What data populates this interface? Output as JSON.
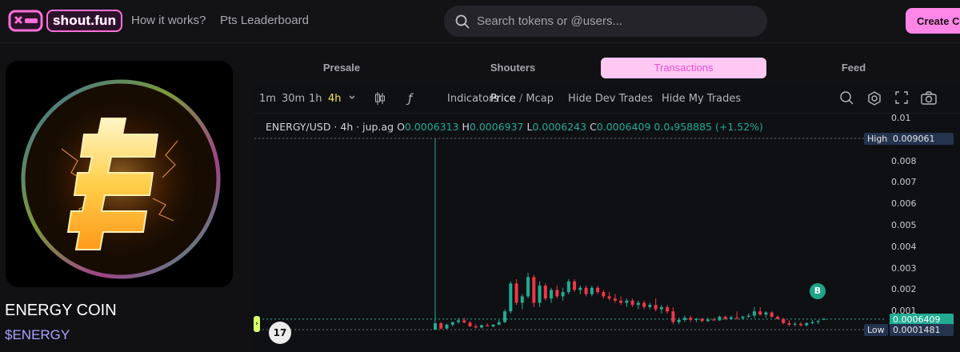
{
  "brand": {
    "name": "shout.fun"
  },
  "nav": {
    "how_it_works": "How it works?",
    "leaderboard": "Pts Leaderboard"
  },
  "search": {
    "placeholder": "Search tokens or @users..."
  },
  "create_button": "Create Coin",
  "coin": {
    "name": "ENERGY COIN",
    "ticker": "$ENERGY"
  },
  "tabs": [
    {
      "label": "Presale",
      "active": false
    },
    {
      "label": "Shouters",
      "active": false
    },
    {
      "label": "Transactions",
      "active": true
    },
    {
      "label": "Feed",
      "active": false
    }
  ],
  "chart_toolbar": {
    "intervals": [
      "1m",
      "30m",
      "1h",
      "4h"
    ],
    "selected_interval": "4h",
    "indicators": "Indicators",
    "price": "Price",
    "separator": "/",
    "mcap": "Mcap",
    "hide_dev": "Hide Dev Trades",
    "hide_my": "Hide My Trades",
    "icons": [
      "candles-icon",
      "fx-icon",
      "zoom-icon",
      "settings-icon",
      "fullscreen-icon",
      "camera-icon"
    ]
  },
  "ohlc": {
    "symbol": "ENERGY/USD · 4h · jup.ag",
    "o_label": "O",
    "o": "0.0006313",
    "h_label": "H",
    "h": "0.0006937",
    "l_label": "L",
    "l": "0.0006243",
    "c_label": "C",
    "c": "0.0006409",
    "change": "0.0₄958885 (+1.52%)"
  },
  "markers": {
    "tv": "17",
    "buy": "B"
  },
  "colors": {
    "up": "#22ab94",
    "down": "#f23645",
    "accent": "#ff86e6",
    "interval_selected": "#f5e44a"
  },
  "chart_data": {
    "type": "candlestick",
    "symbol": "ENERGY/USD",
    "interval": "4h",
    "y_ticks": [
      "0.01",
      "0.008",
      "0.007",
      "0.006",
      "0.005",
      "0.004",
      "0.003",
      "0.002",
      "0.001"
    ],
    "ylim": [
      0,
      0.01
    ],
    "price_tags": [
      {
        "label": "High",
        "value": "0.009061"
      },
      {
        "label": "",
        "value": "0.0006409"
      },
      {
        "label": "Low",
        "value": "0.0001481"
      }
    ],
    "candles": [
      {
        "o": 0.0001481,
        "h": 0.009061,
        "l": 0.0001481,
        "c": 0.00045
      },
      {
        "o": 0.00045,
        "h": 0.0005,
        "l": 0.00015,
        "c": 0.0002
      },
      {
        "o": 0.0002,
        "h": 0.00042,
        "l": 0.00018,
        "c": 0.00038
      },
      {
        "o": 0.00038,
        "h": 0.00052,
        "l": 0.0003,
        "c": 0.0005
      },
      {
        "o": 0.0005,
        "h": 0.0007,
        "l": 0.00042,
        "c": 0.00058
      },
      {
        "o": 0.00058,
        "h": 0.0007,
        "l": 0.00045,
        "c": 0.00048
      },
      {
        "o": 0.00048,
        "h": 0.00055,
        "l": 0.00028,
        "c": 0.0003
      },
      {
        "o": 0.0003,
        "h": 0.0004,
        "l": 0.0002,
        "c": 0.00025
      },
      {
        "o": 0.00025,
        "h": 0.0004,
        "l": 0.0002,
        "c": 0.00035
      },
      {
        "o": 0.00035,
        "h": 0.00045,
        "l": 0.0003,
        "c": 0.0003
      },
      {
        "o": 0.0003,
        "h": 0.0004,
        "l": 0.00025,
        "c": 0.00038
      },
      {
        "o": 0.00038,
        "h": 0.0006,
        "l": 0.00035,
        "c": 0.0005
      },
      {
        "o": 0.0005,
        "h": 0.0011,
        "l": 0.00045,
        "c": 0.001
      },
      {
        "o": 0.001,
        "h": 0.0024,
        "l": 0.0009,
        "c": 0.0023
      },
      {
        "o": 0.0023,
        "h": 0.0025,
        "l": 0.0013,
        "c": 0.0014
      },
      {
        "o": 0.0014,
        "h": 0.0018,
        "l": 0.0011,
        "c": 0.0017
      },
      {
        "o": 0.0017,
        "h": 0.0028,
        "l": 0.0016,
        "c": 0.0026
      },
      {
        "o": 0.0026,
        "h": 0.0027,
        "l": 0.0012,
        "c": 0.0014
      },
      {
        "o": 0.0014,
        "h": 0.0024,
        "l": 0.0012,
        "c": 0.0022
      },
      {
        "o": 0.0022,
        "h": 0.0023,
        "l": 0.0015,
        "c": 0.0016
      },
      {
        "o": 0.0016,
        "h": 0.0021,
        "l": 0.0014,
        "c": 0.002
      },
      {
        "o": 0.002,
        "h": 0.0022,
        "l": 0.0016,
        "c": 0.0017
      },
      {
        "o": 0.0017,
        "h": 0.0021,
        "l": 0.0015,
        "c": 0.0019
      },
      {
        "o": 0.0019,
        "h": 0.0025,
        "l": 0.0018,
        "c": 0.0024
      },
      {
        "o": 0.0024,
        "h": 0.0025,
        "l": 0.0019,
        "c": 0.002
      },
      {
        "o": 0.002,
        "h": 0.0022,
        "l": 0.0018,
        "c": 0.0021
      },
      {
        "o": 0.0021,
        "h": 0.0022,
        "l": 0.0017,
        "c": 0.0018
      },
      {
        "o": 0.0018,
        "h": 0.0022,
        "l": 0.0017,
        "c": 0.0021
      },
      {
        "o": 0.0021,
        "h": 0.0022,
        "l": 0.0018,
        "c": 0.0019
      },
      {
        "o": 0.0019,
        "h": 0.002,
        "l": 0.0016,
        "c": 0.0017
      },
      {
        "o": 0.0017,
        "h": 0.0019,
        "l": 0.0015,
        "c": 0.0016
      },
      {
        "o": 0.0016,
        "h": 0.0018,
        "l": 0.0014,
        "c": 0.0015
      },
      {
        "o": 0.0015,
        "h": 0.0017,
        "l": 0.0013,
        "c": 0.0014
      },
      {
        "o": 0.0014,
        "h": 0.0016,
        "l": 0.0012,
        "c": 0.0015
      },
      {
        "o": 0.0015,
        "h": 0.0016,
        "l": 0.0012,
        "c": 0.0013
      },
      {
        "o": 0.0013,
        "h": 0.0015,
        "l": 0.0011,
        "c": 0.0014
      },
      {
        "o": 0.0014,
        "h": 0.0015,
        "l": 0.0011,
        "c": 0.0012
      },
      {
        "o": 0.0012,
        "h": 0.0014,
        "l": 0.0011,
        "c": 0.0013
      },
      {
        "o": 0.0013,
        "h": 0.0016,
        "l": 0.001,
        "c": 0.0011
      },
      {
        "o": 0.0011,
        "h": 0.0013,
        "l": 0.0009,
        "c": 0.0012
      },
      {
        "o": 0.0012,
        "h": 0.0013,
        "l": 0.0009,
        "c": 0.001
      },
      {
        "o": 0.001,
        "h": 0.0012,
        "l": 0.0004,
        "c": 0.0005
      },
      {
        "o": 0.0005,
        "h": 0.0007,
        "l": 0.0004,
        "c": 0.0006
      },
      {
        "o": 0.0006,
        "h": 0.0008,
        "l": 0.0005,
        "c": 0.0007
      },
      {
        "o": 0.0007,
        "h": 0.0008,
        "l": 0.0005,
        "c": 0.0006
      },
      {
        "o": 0.0006,
        "h": 0.0007,
        "l": 0.0005,
        "c": 0.00065
      },
      {
        "o": 0.00065,
        "h": 0.0007,
        "l": 0.0005,
        "c": 0.00055
      },
      {
        "o": 0.00055,
        "h": 0.0007,
        "l": 0.0005,
        "c": 0.00062
      },
      {
        "o": 0.00062,
        "h": 0.0007,
        "l": 0.00055,
        "c": 0.00058
      },
      {
        "o": 0.00058,
        "h": 0.0008,
        "l": 0.00055,
        "c": 0.00075
      },
      {
        "o": 0.00075,
        "h": 0.0008,
        "l": 0.0006,
        "c": 0.00065
      },
      {
        "o": 0.00065,
        "h": 0.0008,
        "l": 0.0006,
        "c": 0.00072
      },
      {
        "o": 0.00072,
        "h": 0.001,
        "l": 0.0006,
        "c": 0.00068
      },
      {
        "o": 0.00068,
        "h": 0.0008,
        "l": 0.0006,
        "c": 0.00075
      },
      {
        "o": 0.00075,
        "h": 0.0009,
        "l": 0.0007,
        "c": 0.0008
      },
      {
        "o": 0.0008,
        "h": 0.0012,
        "l": 0.0007,
        "c": 0.001
      },
      {
        "o": 0.001,
        "h": 0.0012,
        "l": 0.0008,
        "c": 0.00085
      },
      {
        "o": 0.00085,
        "h": 0.001,
        "l": 0.0007,
        "c": 0.00095
      },
      {
        "o": 0.00095,
        "h": 0.001,
        "l": 0.0007,
        "c": 0.00075
      },
      {
        "o": 0.00075,
        "h": 0.0008,
        "l": 0.0006,
        "c": 0.00065
      },
      {
        "o": 0.00065,
        "h": 0.0007,
        "l": 0.0004,
        "c": 0.00045
      },
      {
        "o": 0.00045,
        "h": 0.0006,
        "l": 0.0003,
        "c": 0.00038
      },
      {
        "o": 0.00038,
        "h": 0.0005,
        "l": 0.0003,
        "c": 0.00042
      },
      {
        "o": 0.00042,
        "h": 0.0005,
        "l": 0.0003,
        "c": 0.00035
      },
      {
        "o": 0.00035,
        "h": 0.0005,
        "l": 0.0003,
        "c": 0.00045
      },
      {
        "o": 0.00045,
        "h": 0.0006,
        "l": 0.0004,
        "c": 0.0005
      },
      {
        "o": 0.0005,
        "h": 0.0006,
        "l": 0.0004,
        "c": 0.00055
      },
      {
        "o": 0.0006313,
        "h": 0.0006937,
        "l": 0.0006243,
        "c": 0.0006409
      }
    ]
  }
}
